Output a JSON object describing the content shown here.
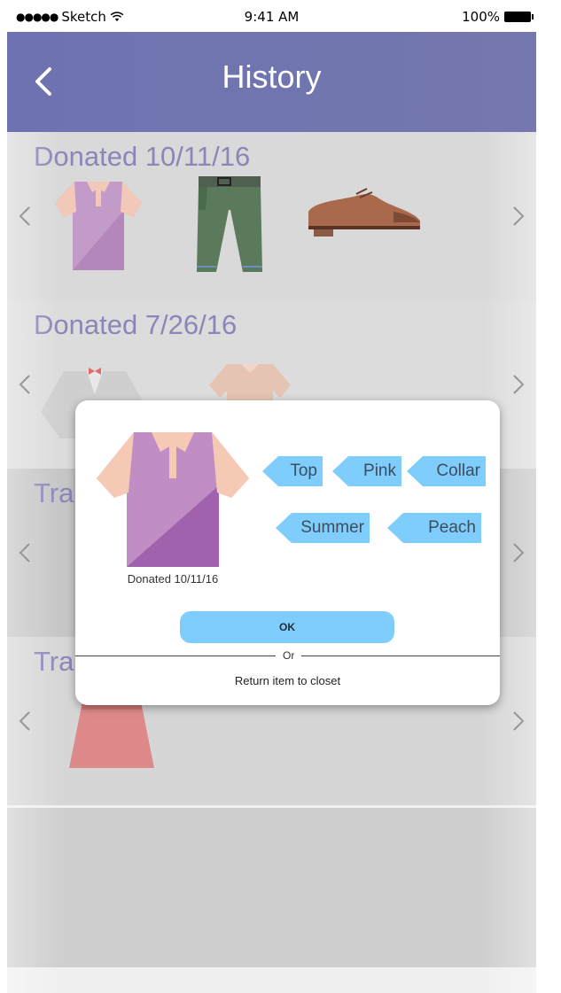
{
  "status_bar": {
    "carrier": "Sketch",
    "signal_dots": "●●●●●",
    "time": "9:41 AM",
    "battery": "100%"
  },
  "header": {
    "title": "History"
  },
  "sections": [
    {
      "title": "Donated 10/11/16"
    },
    {
      "title": "Donated 7/26/16"
    },
    {
      "title": "Tra"
    },
    {
      "title": "Tra"
    }
  ],
  "modal": {
    "caption": "Donated 10/11/16",
    "tags": [
      "Top",
      "Pink",
      "Collar",
      "Summer",
      "Peach"
    ],
    "ok_label": "OK",
    "or_label": "Or",
    "return_label": "Return item to closet"
  },
  "colors": {
    "header": "#7074ae",
    "section_title": "#8a86b8",
    "tag": "#7ecdfc",
    "shirt": "#a873b8",
    "shirt_accent": "#f5c9b4"
  }
}
